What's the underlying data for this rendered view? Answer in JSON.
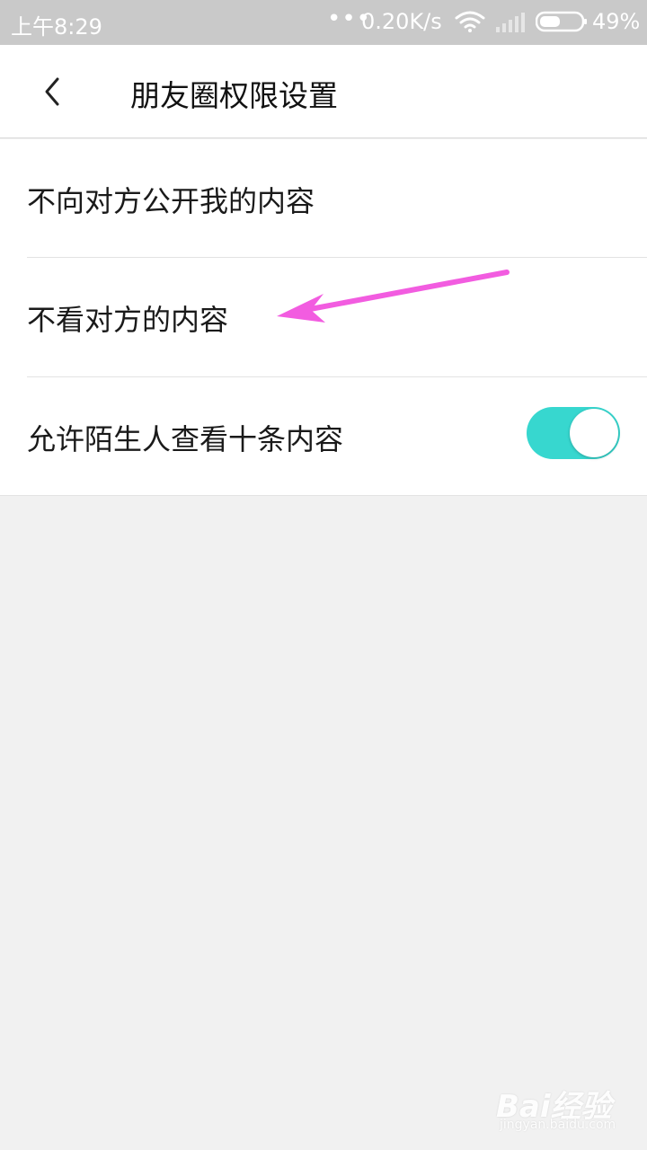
{
  "status_bar": {
    "time": "上午8:29",
    "dots": "•••",
    "network_speed": "0.20K/s",
    "battery_percent": "49%",
    "battery_level": 0.49,
    "icons": [
      "wifi-icon",
      "signal-icon",
      "battery-icon"
    ]
  },
  "header": {
    "back_icon": "back-chevron-icon",
    "title": "朋友圈权限设置"
  },
  "settings": {
    "items": [
      {
        "label": "不向对方公开我的内容"
      },
      {
        "label": "不看对方的内容"
      },
      {
        "label": "允许陌生人查看十条内容",
        "toggle_on": true
      }
    ]
  },
  "colors": {
    "toggle_on": "#37d7cf",
    "annotation_arrow": "#f25ce0",
    "status_bar_bg": "#c9c9c9",
    "page_bg": "#f1f1f1"
  },
  "annotation": {
    "type": "arrow",
    "color": "#f25ce0",
    "points_to": "不看对方的内容"
  },
  "watermark": {
    "brand": "Bai经验",
    "sub": "jingyan.baidu.com"
  }
}
